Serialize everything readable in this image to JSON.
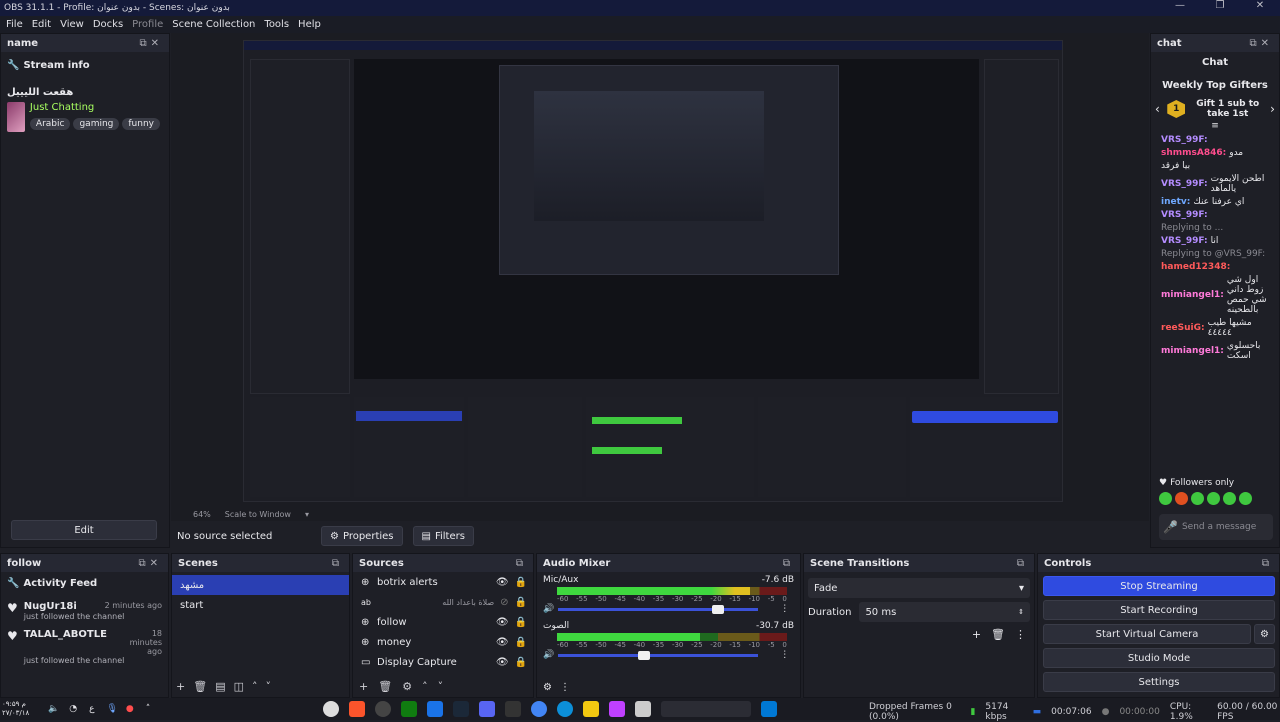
{
  "window": {
    "title": "OBS 31.1.1 - Profile: بدون عنوان - Scenes: بدون عنوان"
  },
  "menu": [
    "File",
    "Edit",
    "View",
    "Docks",
    "Profile",
    "Scene Collection",
    "Tools",
    "Help"
  ],
  "name_dock": {
    "title": "name",
    "stream_info": "Stream info",
    "channel_title": "هقعت الليييل",
    "category": "Just Chatting",
    "tags": [
      "Arabic",
      "gaming",
      "funny"
    ],
    "edit_label": "Edit"
  },
  "preview": {
    "zoom": "64%",
    "scale": "Scale to Window",
    "no_source": "No source selected",
    "properties": "Properties",
    "filters": "Filters"
  },
  "chat_dock": {
    "title": "chat",
    "header": "Chat",
    "gifters_title": "Weekly Top Gifters",
    "gift_text": "Gift 1 sub to take 1st",
    "gift_rank": "1",
    "messages": [
      {
        "user": "VRS_99F:",
        "text": "",
        "color": "#b48cff"
      },
      {
        "user": "shmmsA846:",
        "text": "مدو",
        "color": "#ff4d8d"
      },
      {
        "user": "",
        "text": "بيا فرقد",
        "color": "#e8e8ec"
      },
      {
        "user": "VRS_99F:",
        "text": "اطحن الايموت يالماهد",
        "color": "#b48cff"
      },
      {
        "user": "inetv:",
        "text": "اي عرفنا عنك",
        "color": "#6fa8ff"
      },
      {
        "user": "VRS_99F:",
        "text": "",
        "color": "#b48cff"
      },
      {
        "user": "",
        "text": "Replying to ...",
        "color": "#8a8a92"
      },
      {
        "user": "VRS_99F:",
        "text": "انا",
        "color": "#b48cff"
      },
      {
        "user": "",
        "text": "Replying to @VRS_99F:",
        "color": "#8a8a92"
      },
      {
        "user": "hamed12348:",
        "text": "",
        "color": "#ff5a5a"
      },
      {
        "user": "mimiangel1:",
        "text": "اول شي زوط داني شي حمص بالطحينه",
        "color": "#ff7ad9"
      },
      {
        "user": "reeSuiG:",
        "text": "مشيها طيب ٤٤٤٤٤",
        "color": "#ff5a5a"
      },
      {
        "user": "mimiangel1:",
        "text": "باحسلوي اسكت",
        "color": "#ff7ad9"
      }
    ],
    "followers_only": "Followers only",
    "send_placeholder": "Send a message"
  },
  "follow_dock": {
    "title": "follow",
    "feed_title": "Activity Feed",
    "items": [
      {
        "name": "NugUr18i",
        "time": "2 minutes ago",
        "desc": "just followed the channel"
      },
      {
        "name": "TALAL_ABOTLE",
        "time": "18 minutes ago",
        "desc": "just followed the channel"
      }
    ]
  },
  "scenes_dock": {
    "title": "Scenes",
    "items": [
      "مشهد",
      "start"
    ]
  },
  "sources_dock": {
    "title": "Sources",
    "items": [
      {
        "name": "botrix alerts",
        "icon": "globe-icon"
      },
      {
        "name": "صلاة باعداد الله",
        "icon": "text-icon"
      },
      {
        "name": "follow",
        "icon": "globe-icon"
      },
      {
        "name": "money",
        "icon": "globe-icon"
      },
      {
        "name": "Display Capture",
        "icon": "monitor-icon"
      }
    ]
  },
  "mixer_dock": {
    "title": "Audio Mixer",
    "channels": [
      {
        "name": "Mic/Aux",
        "db": "-7.6 dB",
        "level": 0.84
      },
      {
        "name": "الصوت",
        "db": "-30.7 dB",
        "level": 0.62
      }
    ],
    "ticks": [
      "-60",
      "-55",
      "-50",
      "-45",
      "-40",
      "-35",
      "-30",
      "-25",
      "-20",
      "-15",
      "-10",
      "-5",
      "0"
    ]
  },
  "transitions_dock": {
    "title": "Scene Transitions",
    "selected": "Fade",
    "duration_label": "Duration",
    "duration_value": "50 ms"
  },
  "controls_dock": {
    "title": "Controls",
    "stop_streaming": "Stop Streaming",
    "start_recording": "Start Recording",
    "start_virtual_camera": "Start Virtual Camera",
    "studio_mode": "Studio Mode",
    "settings": "Settings"
  },
  "statusbar": {
    "dropped": "Dropped Frames 0 (0.0%)",
    "kbps": "5174 kbps",
    "stream_time": "00:07:06",
    "rec_time": "00:00:00",
    "cpu": "CPU: 1.9%",
    "fps": "60.00 / 60.00 FPS"
  },
  "taskbar": {
    "time": "م ۰۹:۵۹",
    "date": "۲۷/۰۳/۱۸",
    "lang": "ع"
  },
  "colors": {
    "accent": "#2a3fb3",
    "button_blue": "#2f4be0",
    "bg": "#1e1f26"
  }
}
